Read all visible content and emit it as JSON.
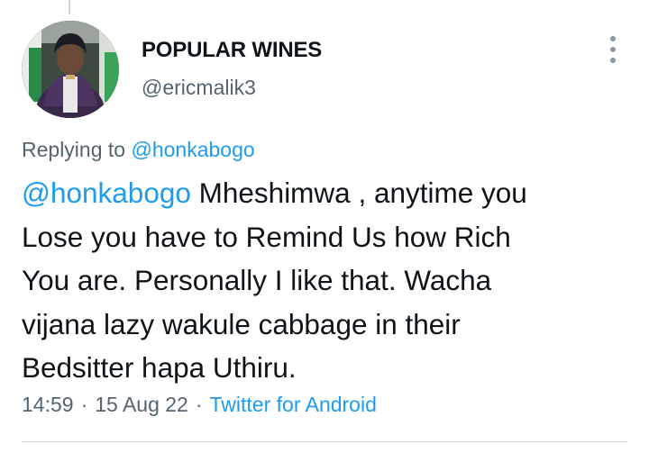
{
  "tweet": {
    "author": {
      "display_name": "POPULAR WINES",
      "handle": "@ericmalik3"
    },
    "more_icon": "more-vertical-icon",
    "replying_to": {
      "prefix": "Replying to",
      "handle": "@honkabogo"
    },
    "text": {
      "mention": "@honkabogo",
      "line1_rest": " Mheshimwa , anytime you",
      "line2": "Lose you have to Remind Us how Rich",
      "line3": "You are. Personally I like that. Wacha",
      "line4": "vijana lazy wakule cabbage in their",
      "line5": "Bedsitter hapa Uthiru."
    },
    "meta": {
      "time": "14:59",
      "separator": "·",
      "date": "15 Aug 22",
      "source": "Twitter for Android"
    }
  },
  "colors": {
    "link": "#1d9bf0",
    "secondary_text": "#536471",
    "primary_text": "#0f1419",
    "divider": "#cfd9de"
  }
}
